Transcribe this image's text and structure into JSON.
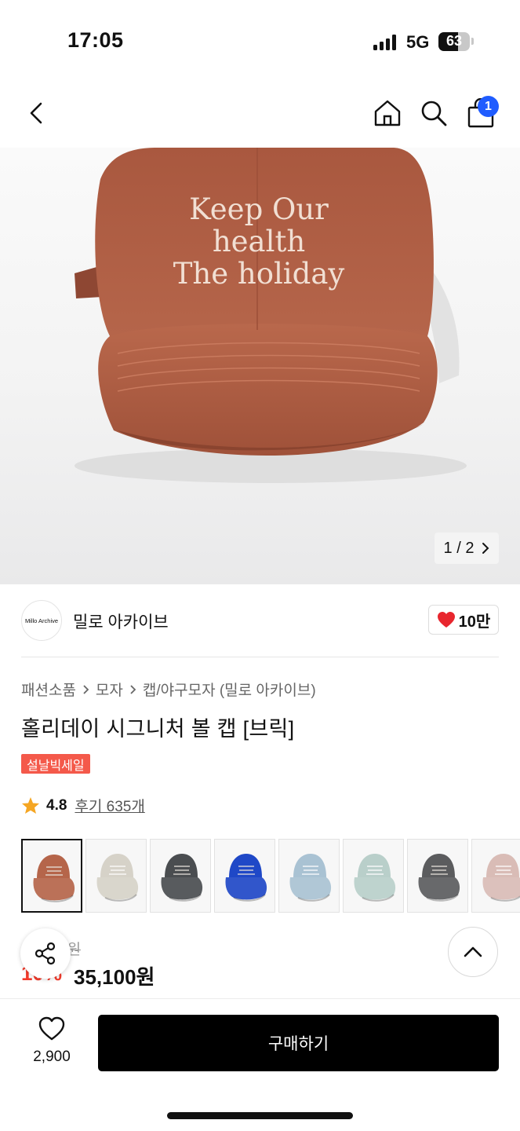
{
  "status_bar": {
    "time": "17:05",
    "network": "5G",
    "battery": "63",
    "battery_level": 0.63
  },
  "nav": {
    "back_icon": "chevron-left-icon",
    "home_icon": "home-icon",
    "search_icon": "search-icon",
    "cart_icon": "shopping-bag-icon",
    "cart_badge": "1"
  },
  "hero": {
    "cap_text": [
      "Keep Our",
      "health",
      "The holiday"
    ],
    "counter_current": "1",
    "counter_sep": "/",
    "counter_total": "2",
    "counter_next_icon": "chevron-right-icon",
    "cap_color": "#b5654a"
  },
  "store": {
    "logo_text": "Millo Archive",
    "name": "밀로 아카이브",
    "like_count": "10만",
    "like_icon": "heart-icon"
  },
  "breadcrumb": [
    "패션소품",
    "모자",
    "캡/야구모자 (밀로 아카이브)"
  ],
  "product": {
    "title": "홀리데이 시그니처 볼 캡 [브릭]",
    "badge": "설날빅세일",
    "rating": "4.8",
    "review_label": "후기 635개"
  },
  "thumbnails": {
    "colors": [
      "#b5654a",
      "#d6d2c8",
      "#4a4d50",
      "#1f48c7",
      "#a9c2d3",
      "#b9cfca",
      "#5b5c5e",
      "#d9bcb6"
    ]
  },
  "price": {
    "original": "0원",
    "discount": "10%",
    "sale": "35,100원"
  },
  "bottom": {
    "wish_count": "2,900",
    "buy_label": "구매하기"
  },
  "colors": {
    "accent_blue": "#1f5cff",
    "discount_red": "#f23b2c",
    "badge_red": "#f4594a",
    "like_red": "#e8262e"
  }
}
